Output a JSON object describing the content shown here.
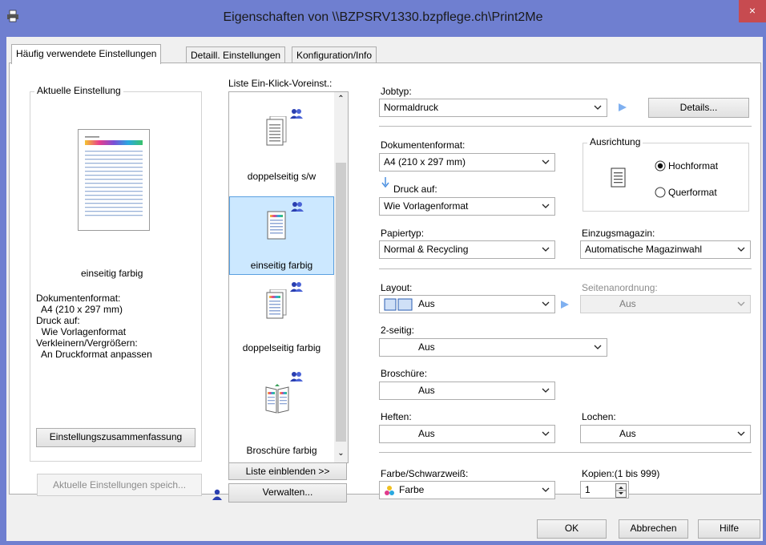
{
  "window": {
    "title": "Eigenschaften von \\\\BZPSRV1330.bzpflege.ch\\Print2Me",
    "close_glyph": "×"
  },
  "tabs": [
    "Häufig verwendete Einstellungen",
    "Detaill. Einstellungen",
    "Konfiguration/Info"
  ],
  "current": {
    "group_title": "Aktuelle Einstellung",
    "preview_caption": "einseitig farbig",
    "info_lines": [
      "Dokumentenformat:",
      "  A4 (210 x 297 mm)",
      "Druck auf:",
      "  Wie Vorlagenformat",
      "Verkleinern/Vergrößern:",
      "  An Druckformat anpassen"
    ],
    "summary_button": "Einstellungszusammenfassung",
    "save_button": "Aktuelle Einstellungen speich..."
  },
  "presets": {
    "label": "Liste Ein-Klick-Voreinst.:",
    "items": [
      {
        "label": "doppelseitig s/w",
        "selected": false
      },
      {
        "label": "einseitig farbig",
        "selected": true
      },
      {
        "label": "doppelseitig farbig",
        "selected": false
      },
      {
        "label": "Broschüre farbig",
        "selected": false
      }
    ],
    "show_list_button": "Liste einblenden >>",
    "manage_button": "Verwalten..."
  },
  "job": {
    "label": "Jobtyp:",
    "value": "Normaldruck",
    "details_button": "Details..."
  },
  "paper": {
    "docformat_label": "Dokumentenformat:",
    "docformat_value": "A4 (210 x 297 mm)",
    "printon_label": "Druck auf:",
    "printon_value": "Wie Vorlagenformat",
    "type_label": "Papiertyp:",
    "type_value": "Normal & Recycling",
    "tray_label": "Einzugsmagazin:",
    "tray_value": "Automatische Magazinwahl"
  },
  "orientation": {
    "title": "Ausrichtung",
    "options": [
      "Hochformat",
      "Querformat"
    ],
    "selected": "Hochformat"
  },
  "layout": {
    "layout_label": "Layout:",
    "layout_value": "Aus",
    "order_label": "Seitenanordnung:",
    "order_value": "Aus",
    "duplex_label": "2-seitig:",
    "duplex_value": "Aus",
    "booklet_label": "Broschüre:",
    "booklet_value": "Aus",
    "staple_label": "Heften:",
    "staple_value": "Aus",
    "punch_label": "Lochen:",
    "punch_value": "Aus"
  },
  "color": {
    "label": "Farbe/Schwarzweiß:",
    "value": "Farbe"
  },
  "copies": {
    "label": "Kopien:(1 bis 999)",
    "value": "1"
  },
  "buttons": {
    "ok": "OK",
    "cancel": "Abbrechen",
    "help": "Hilfe"
  },
  "colors": {
    "titlebar": "#6f7fd0",
    "close": "#c74b50",
    "selection": "#cce8ff",
    "selection_border": "#5aa0e0"
  }
}
